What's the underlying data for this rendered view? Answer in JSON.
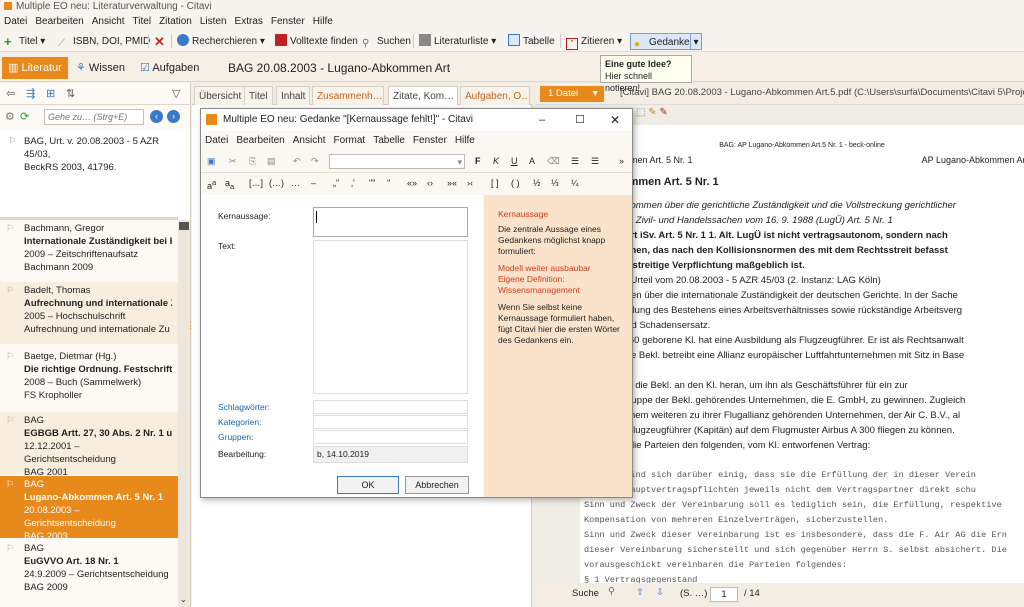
{
  "window": {
    "title": "Multiple EO neu: Literaturverwaltung - Citavi"
  },
  "menu": [
    "Datei",
    "Bearbeiten",
    "Ansicht",
    "Titel",
    "Zitation",
    "Listen",
    "Extras",
    "Fenster",
    "Hilfe"
  ],
  "toolbar": {
    "titel": "Titel",
    "isbn": "ISBN, DOI, PMID",
    "recherchieren": "Recherchieren",
    "volltexte": "Volltexte finden",
    "suchen": "Suchen",
    "literaturliste": "Literaturliste",
    "tabelle": "Tabelle",
    "zitieren": "Zitieren",
    "gedanke": "Gedanke"
  },
  "tooltip": {
    "line1": "Eine gute Idee?",
    "line2": "Hier schnell notieren!"
  },
  "nav": {
    "literatur": "Literatur",
    "wissen": "Wissen",
    "aufgaben": "Aufgaben",
    "heading": "BAG 20.08.2003 - Lugano-Abkommen Art"
  },
  "search": {
    "placeholder": "Gehe zu… (Strg+E)"
  },
  "top_entry": {
    "line1": "BAG, Urt. v. 20.08.2003 - 5 AZR 45/03,",
    "line2": "BeckRS 2003, 41796."
  },
  "references": [
    {
      "author": "Bachmann, Gregor",
      "title": "Internationale Zuständigkeit bei Ko",
      "meta": "2009 – Zeitschriftenaufsatz",
      "short": "Bachmann 2009"
    },
    {
      "author": "Badelt, Thomas",
      "title": "Aufrechnung und internationale Zu",
      "meta": "2005 – Hochschulschrift",
      "short": "Aufrechnung und internationale Zu"
    },
    {
      "author": "Baetge, Dietmar (Hg.)",
      "title": "Die richtige Ordnung. Festschrift f",
      "meta": "2008 – Buch (Sammelwerk)",
      "short": "FS Kropholler"
    },
    {
      "author": "BAG",
      "title": "EGBGB Artt. 27, 30 Abs. 2 Nr. 1 und",
      "meta": "12.12.2001 – Gerichtsentscheidung",
      "short": "BAG 2001"
    },
    {
      "author": "BAG",
      "title": "Lugano-Abkommen Art. 5 Nr. 1",
      "meta": "20.08.2003 – Gerichtsentscheidung",
      "short": "BAG 2003"
    },
    {
      "author": "BAG",
      "title": "EuGVVO Art. 18 Nr. 1",
      "meta": "24.9.2009 – Gerichtsentscheidung",
      "short": "BAG 2009"
    }
  ],
  "mid_tabs": [
    "Übersicht",
    "Titel",
    "Inhalt",
    "Zusammenh…",
    "Zitate, Kom…",
    "Aufgaben, O…"
  ],
  "pdf": {
    "files": "1 Datei",
    "path": "[Citavi]  BAG 20.08.2003 - Lugano-Abkommen Art.5.pdf  (C:\\Users\\surfa\\Documents\\Citavi 5\\Projects\\M",
    "header_center": "BAG: AP Lugano-Abkommen Art.5 Nr. 1 - beck-online",
    "header_left": "ano-Abkommen Art. 5 Nr. 1",
    "header_right": "AP Lugano-Abkommen Art. 5 Nr",
    "heading": "no-Abkommen Art. 5 Nr. 1",
    "lines": [
      "o-Übereinkommen über die gerichtliche Zuständigkeit und die Vollstreckung gerichtlicher",
      "eidungen in Zivil- und Handelssachen vom 16. 9. 1988 (LugÜ) Art. 5 Nr. 1",
      "rfüllungsort iSv. Art. 5 Nr. 1 1. Alt. LugÜ ist nicht vertragsautonom, sondern nach",
      "zu bestimmen, das nach den Kollisionsnormen des mit dem Rechtsstreit befasst",
      "nts für die streitige Verpflichtung maßgeblich ist.",
      "5. Senat ), Urteil vom 20.08.2003 - 5 AZR 45/03 (2. Instanz: LAG Köln)",
      "rteien streiten über die internationale Zuständigkeit der deutschen Gerichte. In der Sache",
      "die Feststellung des Bestehens eines Arbeitsverhältnisses sowie rückständige Arbeitsverg",
      "ndungs- und Schadensersatz.",
      "n 21. 6. 1960 geborene Kl. hat eine Ausbildung als Flugzeugführer. Er ist als Rechtsanwalt",
      "elassen. Die Bekl. betreibt eine Allianz europäischer Luftfahrtunternehmen mit Sitz in Base",
      "eiz).",
      "re 1998 trat die Bekl. an den Kl. heran, um ihn als Geschäftsführer für ein zur",
      "nehmensgruppe der Bekl. gehörendes Unternehmen, die E. GmbH, zu gewinnen. Zugleich",
      "l. an, bei einem weiteren zu ihrer Flugallianz gehörenden Unternehmen, der Air C. B.V., al",
      "wortlicher Flugzeugführer (Kapitän) auf dem Flugmuster Airbus A 300 fliegen zu können.",
      "schlossen die Parteien den folgenden, vom Kl. entworfenen Vertrag:"
    ],
    "mono": [
      "mbel",
      "arteien sind sich darüber einig, dass sie die Erfüllung der in dieser Verein",
      "ommenen Hauptvertragspflichten jeweils nicht dem Vertragspartner direkt schu",
      "Sinn und Zweck der Vereinbarung soll es lediglich sein, die Erfüllung, respektive",
      "Kompensation von mehreren Einzelverträgen, sicherzustellen.",
      "Sinn und Zweck dieser Vereinbarung ist es insbesondere, dass die F. Air AG die Ern",
      "dieser Vereinbarung sicherstellt und sich gegenüber Herrn S. selbst absichert. Die",
      "vorausgeschickt vereinbaren die Parteien folgendes:",
      "§ 1 Vertragsgegenstand"
    ],
    "search_label": "Suche",
    "search_value": "(S. …)",
    "page_current": "1",
    "page_total": "/ 14"
  },
  "dialog": {
    "title": "Multiple EO neu: Gedanke \"[Kernaussage fehlt!]\" - Citavi",
    "menu": [
      "Datei",
      "Bearbeiten",
      "Ansicht",
      "Format",
      "Tabelle",
      "Fenster",
      "Hilfe"
    ],
    "kernaussage": "Kernaussage:",
    "text": "Text:",
    "schlagwoerter": "Schlagwörter:",
    "kategorien": "Kategorien:",
    "gruppen": "Gruppen:",
    "bearbeitung": "Bearbeitung:",
    "bearbeitung_value": "b, 14.10.2019",
    "ok": "OK",
    "abbrechen": "Abbrechen",
    "hint_title": "Kernaussage",
    "hint_text": "Die zentrale Aussage eines Gedankens möglichst knapp formuliert:",
    "hint_red1": "Modell weiter ausbaubar",
    "hint_red2": "Eigene Definition: Wissensmanagement",
    "hint_text2": "Wenn Sie selbst keine Kernaussage formuliert haben, fügt Citavi hier die ersten Wörter des Gedankens ein."
  },
  "colors": {
    "accent": "#e8891c",
    "hint_bg": "#fbe3cb"
  }
}
